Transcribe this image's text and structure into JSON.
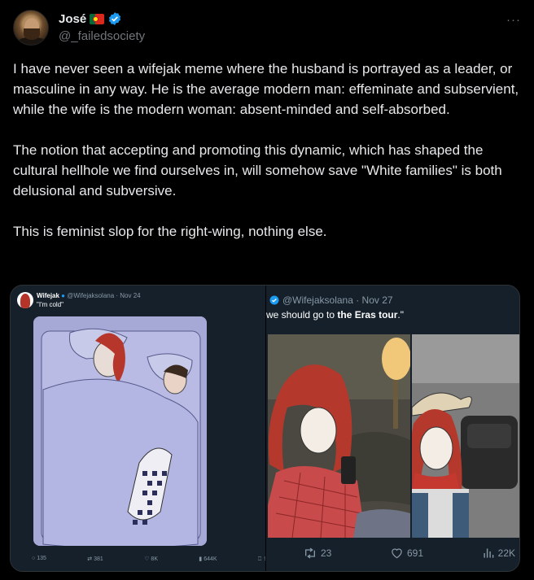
{
  "author": {
    "name": "José",
    "handle": "@_failedsociety",
    "more_label": "···"
  },
  "tweet": {
    "paragraphs": [
      "I have never seen a wifejak meme where the husband is portrayed as a leader, or masculine in any way. He is the average modern man: effeminate and subservient, while the wife is the modern woman: absent-minded and self-absorbed.",
      "The notion that accepting and promoting this dynamic, which has shaped the cultural hellhole we find ourselves in, will somehow save \"White families\" is both delusional and subversive.",
      "This is feminist slop for the right-wing, nothing else."
    ]
  },
  "media": {
    "left": {
      "name": "Wifejak",
      "handle_date": "@Wifejaksolana · Nov 24",
      "text": "\"I'm cold\"",
      "stats": {
        "replies": "135",
        "retweets": "381",
        "likes": "8K",
        "views": "644K"
      }
    },
    "right": {
      "handle_date": "@Wifejaksolana · Nov 27",
      "text_before": "we should go to ",
      "text_bold": "the Eras tour",
      "text_after": ".\"",
      "stats": {
        "retweets": "23",
        "likes": "691",
        "views": "22K"
      }
    }
  },
  "colors": {
    "background": "#000000",
    "text": "#e7e9ea",
    "muted": "#71767b",
    "verified": "#1d9bf0",
    "embed_bg": "#15202b"
  }
}
